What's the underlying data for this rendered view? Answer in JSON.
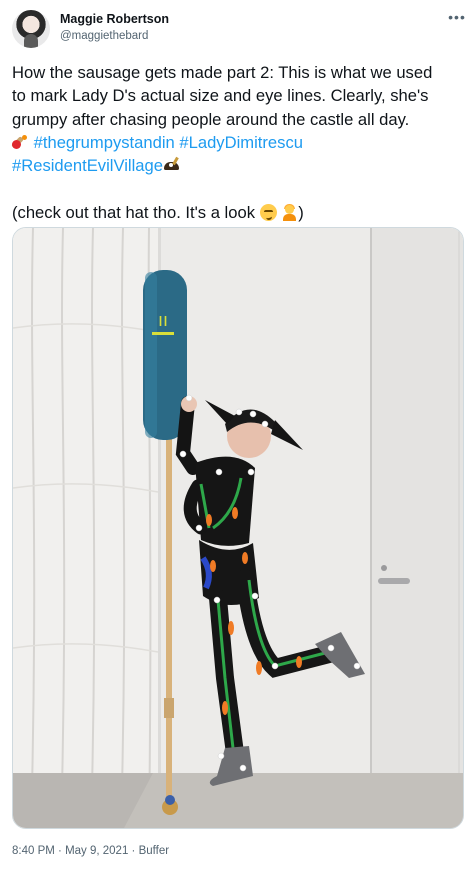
{
  "author": {
    "display_name": "Maggie Robertson",
    "handle": "@maggiethebard"
  },
  "menu_icon": "more-horizontal-icon",
  "tweet": {
    "lines": [
      "How the sausage gets made part 2: This is what we used",
      "to mark Lady D's actual size and eye lines. Clearly, she's",
      "grumpy after chasing people around the castle all day."
    ],
    "hashtag_1": "#thegrumpystandin",
    "hashtag_2": "#LadyDimitrescu",
    "hashtag_3": "#ResidentEvilVillage",
    "closing_text_pre": "(check out that hat tho. It's a look ",
    "closing_text_post": ")",
    "emojis": [
      "cannon-emoji",
      "pirate-hat-emoji",
      "smirk-emoji",
      "tipping-hand-person-emoji"
    ]
  },
  "media": {
    "stick_face_text": "ıı"
  },
  "meta": {
    "time": "8:40 PM",
    "separator": " · ",
    "date": "May 9, 2021",
    "source": "Buffer"
  },
  "colors": {
    "link": "#1d9bf0",
    "secondary_text": "#536471",
    "text": "#0f1419"
  }
}
